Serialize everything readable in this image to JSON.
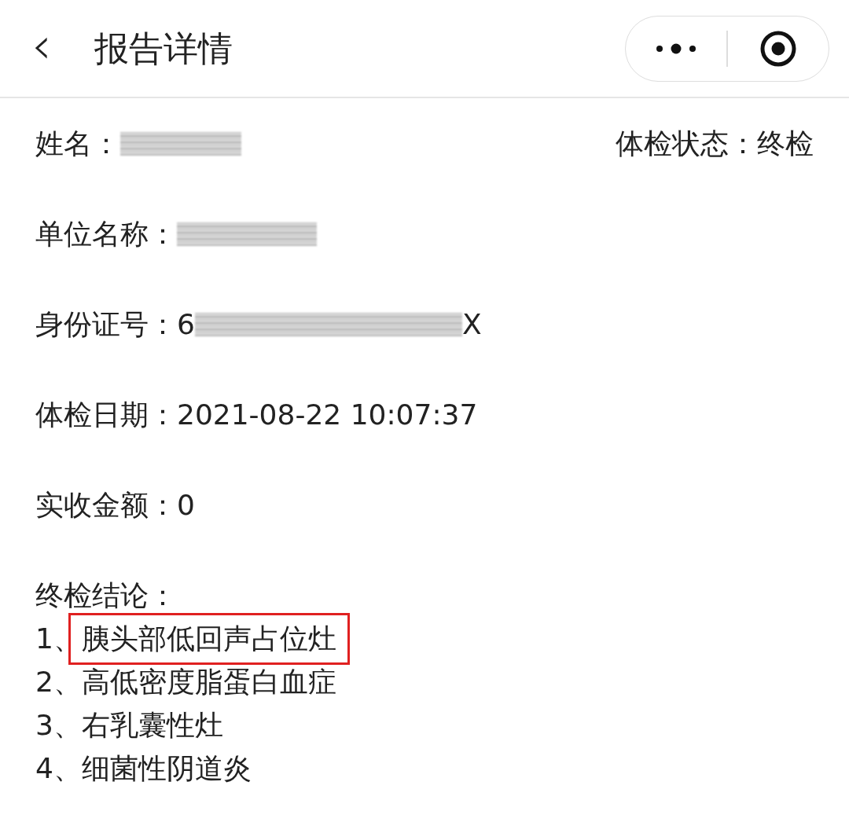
{
  "header": {
    "back_icon": "‹",
    "title": "报告详情"
  },
  "fields": [
    {
      "kind": "blurred",
      "label": "姓名：",
      "side": {
        "label": "体检状态：",
        "value": "终检"
      }
    },
    {
      "kind": "blurred",
      "label": "单位名称："
    },
    {
      "kind": "partly_blurred",
      "label": "身份证号：",
      "prefix": "6",
      "suffix": "X"
    },
    {
      "kind": "text",
      "label": "体检日期：",
      "value": "2021-08-22 10:07:37"
    },
    {
      "kind": "text",
      "label": "实收金额：",
      "value": "0"
    }
  ],
  "conclusion": {
    "label": "终检结论：",
    "items": [
      {
        "number": "1、",
        "text": "胰头部低回声占位灶",
        "highlighted": true
      },
      {
        "number": "2、",
        "text": "高低密度脂蛋白血症",
        "highlighted": false
      },
      {
        "number": "3、",
        "text": "右乳囊性灶",
        "highlighted": false
      },
      {
        "number": "4、",
        "text": "细菌性阴道炎",
        "highlighted": false
      }
    ]
  }
}
